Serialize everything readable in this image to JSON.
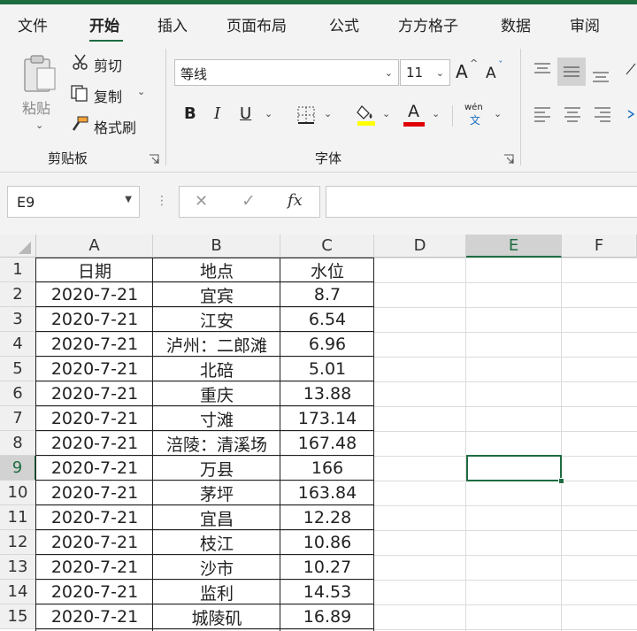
{
  "tabs": [
    "文件",
    "开始",
    "插入",
    "页面布局",
    "公式",
    "方方格子",
    "数据",
    "审阅"
  ],
  "clipboard": {
    "paste_label": "粘贴",
    "cut_label": "剪切",
    "copy_label": "复制",
    "format_painter_label": "格式刷",
    "group_label": "剪贴板"
  },
  "font": {
    "font_name": "等线",
    "font_size": "11",
    "grow_label": "A",
    "shrink_label": "A",
    "bold_label": "B",
    "italic_label": "I",
    "underline_label": "U",
    "font_color_label": "A",
    "phonetic_top": "wén",
    "phonetic_bottom": "文",
    "group_label": "字体",
    "highlight_color": "#ffff00",
    "font_color": "#e00000"
  },
  "formula_bar": {
    "name_box": "E9",
    "cancel_symbol": "✕",
    "enter_symbol": "✓",
    "fx_symbol": "fx",
    "formula": ""
  },
  "columns": [
    "A",
    "B",
    "C",
    "D",
    "E",
    "F"
  ],
  "selected_column": "E",
  "selected_row": "9",
  "rows": [
    {
      "num": "1",
      "a": "日期",
      "b": "地点",
      "c": "水位"
    },
    {
      "num": "2",
      "a": "2020-7-21",
      "b": "宜宾",
      "c": "8.7"
    },
    {
      "num": "3",
      "a": "2020-7-21",
      "b": "江安",
      "c": "6.54"
    },
    {
      "num": "4",
      "a": "2020-7-21",
      "b": "泸州：二郎滩",
      "c": "6.96"
    },
    {
      "num": "5",
      "a": "2020-7-21",
      "b": "北碚",
      "c": "5.01"
    },
    {
      "num": "6",
      "a": "2020-7-21",
      "b": "重庆",
      "c": "13.88"
    },
    {
      "num": "7",
      "a": "2020-7-21",
      "b": "寸滩",
      "c": "173.14"
    },
    {
      "num": "8",
      "a": "2020-7-21",
      "b": "涪陵：清溪场",
      "c": "167.48"
    },
    {
      "num": "9",
      "a": "2020-7-21",
      "b": "万县",
      "c": "166"
    },
    {
      "num": "10",
      "a": "2020-7-21",
      "b": "茅坪",
      "c": "163.84"
    },
    {
      "num": "11",
      "a": "2020-7-21",
      "b": "宜昌",
      "c": "12.28"
    },
    {
      "num": "12",
      "a": "2020-7-21",
      "b": "枝江",
      "c": "10.86"
    },
    {
      "num": "13",
      "a": "2020-7-21",
      "b": "沙市",
      "c": "10.27"
    },
    {
      "num": "14",
      "a": "2020-7-21",
      "b": "监利",
      "c": "14.53"
    },
    {
      "num": "15",
      "a": "2020-7-21",
      "b": "城陵矶",
      "c": "16.89"
    }
  ]
}
